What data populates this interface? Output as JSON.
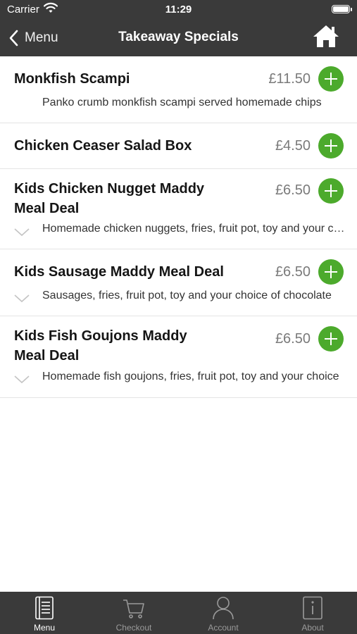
{
  "status_bar": {
    "carrier": "Carrier",
    "time": "11:29"
  },
  "nav": {
    "back_label": "Menu",
    "title": "Takeaway Specials"
  },
  "items": [
    {
      "name": "Monkfish Scampi",
      "price": "£11.50",
      "description": "Panko crumb monkfish scampi served homemade chips"
    },
    {
      "name": "Chicken Ceaser Salad Box",
      "price": "£4.50"
    },
    {
      "name_line1": "Kids Chicken Nugget Maddy",
      "name_line2": "Meal Deal",
      "price": "£6.50",
      "description": "Homemade chicken nuggets, fries, fruit pot, toy and your choice of chocolate"
    },
    {
      "name": "Kids Sausage Maddy Meal Deal",
      "price": "£6.50",
      "description": "Sausages, fries, fruit pot, toy and your choice of chocolate"
    },
    {
      "name_line1": "Kids Fish Goujons Maddy",
      "name_line2": "Meal Deal",
      "price": "£6.50",
      "description": "Homemade fish goujons, fries, fruit pot, toy and your choice"
    }
  ],
  "tabs": [
    {
      "label": "Menu",
      "icon": "book-icon",
      "active": true
    },
    {
      "label": "Checkout",
      "icon": "cart-icon",
      "active": false
    },
    {
      "label": "Account",
      "icon": "person-icon",
      "active": false
    },
    {
      "label": "About",
      "icon": "info-icon",
      "active": false
    }
  ],
  "colors": {
    "bar": "#3a3a3a",
    "accent": "#4caa2c",
    "price": "#7a7a7a",
    "divider": "#e4e4e4"
  }
}
